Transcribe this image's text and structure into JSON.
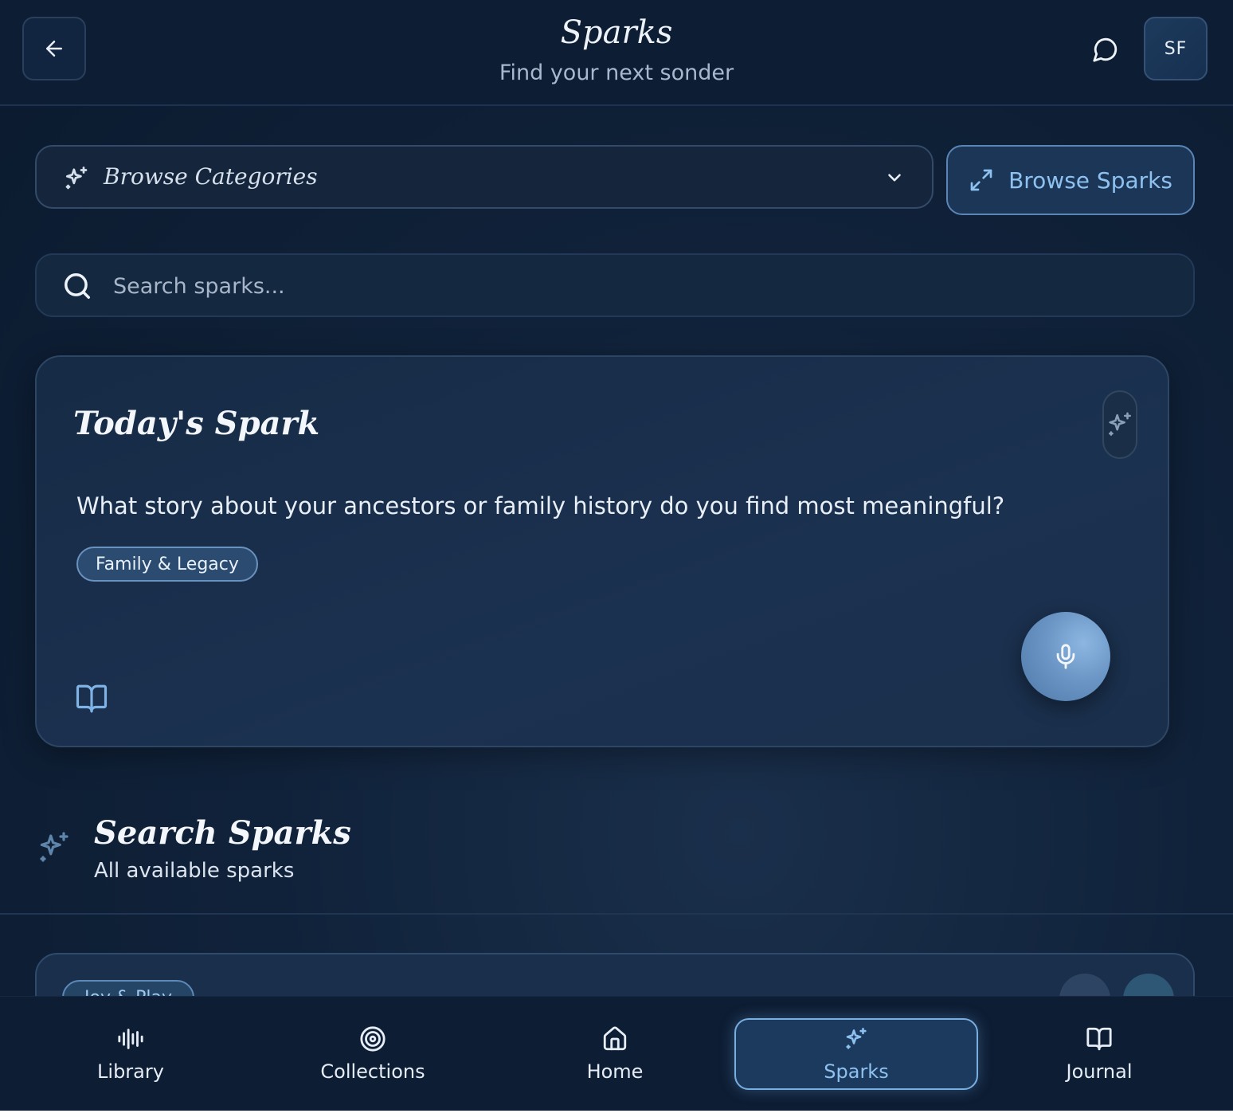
{
  "header": {
    "title": "Sparks",
    "subtitle": "Find your next sonder",
    "avatar_initials": "SF"
  },
  "categories": {
    "label": "Browse Categories"
  },
  "browse_button": {
    "label": "Browse Sparks"
  },
  "search": {
    "placeholder": "Search sparks...",
    "value": ""
  },
  "todays_spark": {
    "title": "Today's Spark",
    "question": "What story about your ancestors or family history do you find most meaningful?",
    "tag": "Family & Legacy"
  },
  "search_section": {
    "title": "Search Sparks",
    "subtitle": "All available sparks"
  },
  "list": {
    "items": [
      {
        "tag": "Joy & Play"
      }
    ]
  },
  "nav": {
    "items": [
      {
        "label": "Library",
        "icon": "waveform-icon"
      },
      {
        "label": "Collections",
        "icon": "target-icon"
      },
      {
        "label": "Home",
        "icon": "home-icon"
      },
      {
        "label": "Sparks",
        "icon": "sparkle-icon",
        "active": true
      },
      {
        "label": "Journal",
        "icon": "book-icon"
      }
    ]
  },
  "colors": {
    "accent": "#8fc1f0",
    "background": "#0d1d33",
    "card": "#1a2f4b"
  }
}
